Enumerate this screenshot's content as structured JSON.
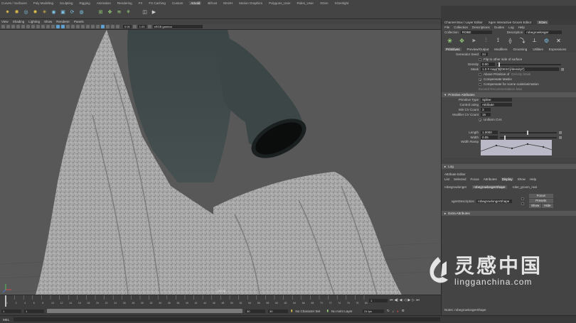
{
  "shelf": {
    "tabs": [
      "Curves / Surfaces",
      "Poly Modeling",
      "Sculpting",
      "Rigging",
      "Animation",
      "Rendering",
      "FX",
      "FX Caching",
      "Custom",
      "Arnold",
      "Bifrost",
      "MASH",
      "Motion Graphics",
      "Polygons_User",
      "Rides_User",
      "XGen",
      "XGenlight"
    ],
    "active_tab": "Arnold"
  },
  "viewport": {
    "menu": [
      "View",
      "Shading",
      "Lighting",
      "Show",
      "Renderer",
      "Panels"
    ],
    "field_a": "0.00",
    "field_b": "1.00",
    "color_space": "sRGB gamma",
    "bottom_label": "persp"
  },
  "timeline": {
    "ticks": [
      "1",
      "2",
      "4",
      "6",
      "8",
      "10",
      "12",
      "14",
      "16",
      "18",
      "20",
      "22",
      "24",
      "26",
      "28",
      "30",
      "32",
      "34",
      "36",
      "38",
      "40",
      "42",
      "44",
      "46",
      "48",
      "50",
      "52",
      "54",
      "56",
      "58",
      "60",
      "62",
      "64",
      "66",
      "68",
      "70",
      "72",
      "74",
      "76",
      "78",
      "80"
    ],
    "current_frame": "1"
  },
  "range": {
    "start": "1",
    "playback_start": "1",
    "playback_end": "30",
    "end": "30",
    "character_set": "No Character Set",
    "anim_layer": "No Anim Layer",
    "fps": "24 fps"
  },
  "cmdline": {
    "label": "MEL"
  },
  "rpanel": {
    "top_tabs": [
      "Channel Box / Layer Editor",
      "Xgen Interactive Groom Editor",
      "XGen"
    ],
    "active_top_tab": "XGen",
    "menu": [
      "File",
      "Collection",
      "Descriptions",
      "Guides",
      "Log",
      "Help"
    ],
    "collection_label": "Collection",
    "collection_value": "ROBE",
    "description_label": "Description",
    "description_value": "robegrowlonger",
    "sub_tabs": [
      "Primitives",
      "Preview/Output",
      "Modifiers",
      "Grooming",
      "Utilities",
      "Expressions"
    ],
    "active_sub_tab": "Primitives",
    "generator_seed_label": "Generator Seed",
    "generator_seed_value": "24",
    "flip_label": "Flip to other side of surface",
    "density_label": "Density",
    "density_value": "0.00",
    "mask_label": "Mask",
    "mask_value": "1.0 # map('${DESC}/density/')",
    "above_label": "Above Primitive of",
    "above_sub": "Density Mask",
    "compensate_label": "Compensate Masks",
    "compensate_scene": "Compensate for scene scale/animation",
    "exceed_label": "Exceed Recommendation Max",
    "primitive_attr_label": "Primitive Attributes",
    "primitive_type_label": "Primitive Type",
    "primitive_type_value": "Spline",
    "control_label": "Control using",
    "control_value": "Attribute",
    "cv_count_label": "Min CV Count",
    "cv_count_value": "3",
    "mod_cv_label": "Modifier CV Count",
    "mod_cv_value": "15",
    "uniform_label": "Uniform CVs",
    "length_label": "Length",
    "length_value": "1.0000",
    "width_label": "Width",
    "width_value": "0.05",
    "width_ramp_label": "Width Ramp",
    "log_label": "Log",
    "attr_editor_label": "Attribute Editor",
    "attr_menu": [
      "List",
      "Selected",
      "Focus",
      "Attributes",
      "Display",
      "Show",
      "Help"
    ],
    "attr_menu_active": "Display",
    "node_tabs": [
      "robegrowlonger",
      "robegrowlongerShape",
      "robe_groom_mat"
    ],
    "node_tab_active": "robegrowlongerShape",
    "xgen_desc_label": "xgenDescription",
    "xgen_desc_value": "robegrowlongerShape",
    "focus_btn": "Focus",
    "presets_btn": "Presets",
    "show_btn": "Show",
    "hide_btn": "Hide",
    "extra_attr_label": "Extra Attributes",
    "notes_label": "Notes: robegrowlongerShape"
  },
  "watermark": {
    "cn": "灵感中国",
    "url": "lingganchina.com"
  },
  "colors": {
    "accent": "#5ea0d0",
    "robe": "#b4b4b4",
    "garment": "#3f4848"
  }
}
